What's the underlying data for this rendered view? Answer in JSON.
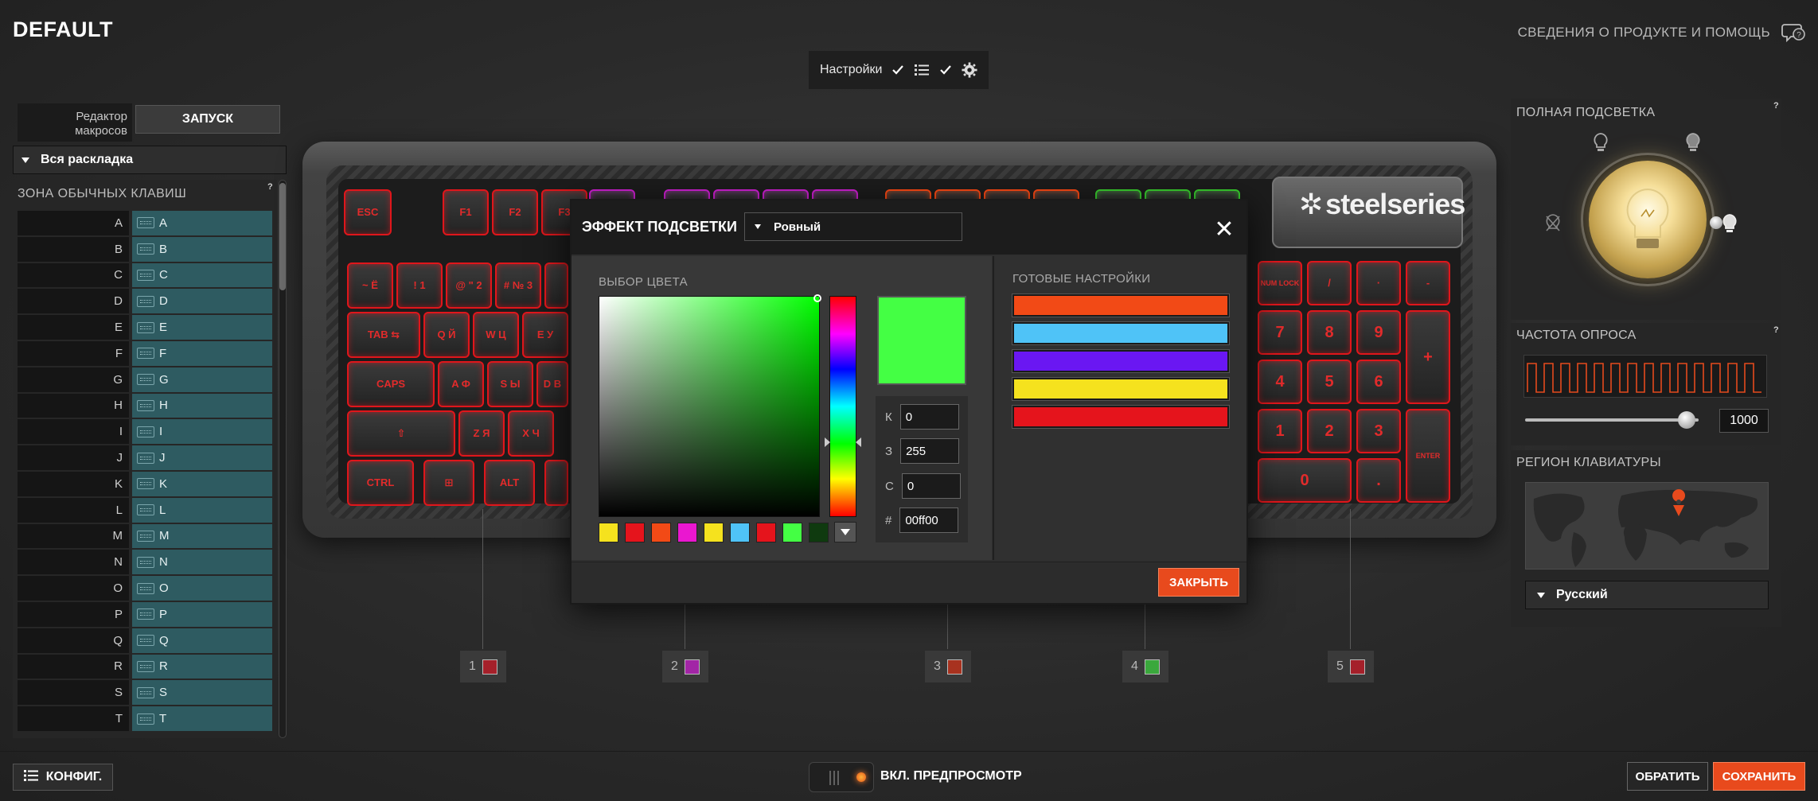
{
  "header": {
    "app_title": "DEFAULT",
    "help_link": "СВЕДЕНИЯ О ПРОДУКТЕ И ПОМОЩЬ",
    "help_icon": "help-chat-icon"
  },
  "settings_bar": {
    "label": "Настройки",
    "check1": true,
    "check2": true
  },
  "left_panel": {
    "macro_label_line1": "Редактор",
    "macro_label_line2": "макросов",
    "launch_button": "ЗАПУСК",
    "layout_select": "Вся раскладка",
    "zone_title": "ЗОНА ОБЫЧНЫХ КЛАВИШ",
    "help": "?",
    "keys": [
      {
        "name": "A",
        "assign": "A"
      },
      {
        "name": "B",
        "assign": "B"
      },
      {
        "name": "C",
        "assign": "C"
      },
      {
        "name": "D",
        "assign": "D"
      },
      {
        "name": "E",
        "assign": "E"
      },
      {
        "name": "F",
        "assign": "F"
      },
      {
        "name": "G",
        "assign": "G"
      },
      {
        "name": "H",
        "assign": "H"
      },
      {
        "name": "I",
        "assign": "I"
      },
      {
        "name": "J",
        "assign": "J"
      },
      {
        "name": "K",
        "assign": "K"
      },
      {
        "name": "L",
        "assign": "L"
      },
      {
        "name": "M",
        "assign": "M"
      },
      {
        "name": "N",
        "assign": "N"
      },
      {
        "name": "O",
        "assign": "O"
      },
      {
        "name": "P",
        "assign": "P"
      },
      {
        "name": "Q",
        "assign": "Q"
      },
      {
        "name": "R",
        "assign": "R"
      },
      {
        "name": "S",
        "assign": "S"
      },
      {
        "name": "T",
        "assign": "T"
      }
    ]
  },
  "keyboard": {
    "brand": "steelseries",
    "keys": {
      "esc": "ESC",
      "f1": "F1",
      "f2": "F2",
      "f3": "F3",
      "tilde": "~ Ё",
      "k1": "! 1",
      "k2": "@ \" 2",
      "k3": "# № 3",
      "tab": "TAB ⇆",
      "q": "Q Й",
      "w": "W Ц",
      "e": "E У",
      "caps": "CAPS",
      "a": "A Ф",
      "s": "S Ы",
      "d": "D В",
      "shift": "⇧",
      "z": "Z Я",
      "x": "X Ч",
      "ctrl": "CTRL",
      "win": "⊞",
      "alt": "ALT",
      "numlock": "NUM LOCK",
      "div": "/",
      "mul": "·",
      "minus": "-",
      "n7": "7",
      "n8": "8",
      "n9": "9",
      "plus": "+",
      "n4": "4",
      "n5": "5",
      "n6": "6",
      "n1": "1",
      "n2": "2",
      "n3": "3",
      "enter": "ENTER",
      "n0": "0",
      "dot": "."
    }
  },
  "zones": [
    {
      "label": "1",
      "color": "#a5202a"
    },
    {
      "label": "2",
      "color": "#a225a6"
    },
    {
      "label": "3",
      "color": "#a8321f"
    },
    {
      "label": "4",
      "color": "#3aa83c"
    },
    {
      "label": "5",
      "color": "#a5202a"
    }
  ],
  "right_panel": {
    "lighting_title": "ПОЛНАЯ ПОДСВЕТКА",
    "poll_title": "ЧАСТОТА ОПРОСА",
    "poll_value": "1000",
    "poll_level": 0.93,
    "region_title": "РЕГИОН КЛАВИАТУРЫ",
    "region_select": "Русский",
    "help": "?"
  },
  "modal": {
    "title": "ЭФФЕКТ ПОДСВЕТКИ",
    "effect": "Ровный",
    "color_pick_label": "ВЫБОР ЦВЕТА",
    "presets_label": "ГОТОВЫЕ НАСТРОЙКИ",
    "rgb": {
      "r_label": "К",
      "r": "0",
      "g_label": "З",
      "g": "255",
      "b_label": "С",
      "b": "0",
      "hex_label": "#",
      "hex": "00ff00"
    },
    "preview_color": "#44ff44",
    "recent_colors": [
      "#f5e21e",
      "#e5141c",
      "#f24a16",
      "#ea17d0",
      "#f5e21e",
      "#4fc3f7",
      "#e5141c",
      "#44ff44",
      "#0f3a0f"
    ],
    "presets": [
      "#f24a16",
      "#4fc3f7",
      "#6a17f2",
      "#f5e21e",
      "#e5141c"
    ],
    "close_button": "ЗАКРЫТЬ"
  },
  "footer": {
    "config_button": "КОНФИГ.",
    "preview_label": "ВКЛ. ПРЕДПРОСМОТР",
    "revert_button": "ОБРАТИТЬ",
    "save_button": "СОХРАНИТЬ"
  }
}
